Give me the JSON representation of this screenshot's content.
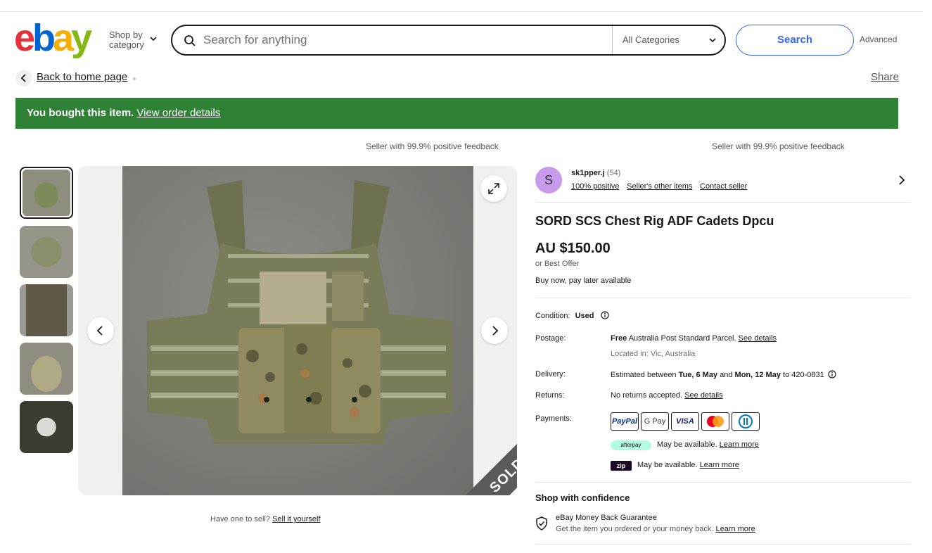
{
  "header": {
    "logo_letters": [
      "e",
      "b",
      "a",
      "y"
    ],
    "shop_by_line1": "Shop by",
    "shop_by_line2": "category",
    "search_placeholder": "Search for anything",
    "category_select": "All Categories",
    "search_button": "Search",
    "advanced_link": "Advanced"
  },
  "nav": {
    "back_link": "Back to home page",
    "share_link": "Share"
  },
  "banner": {
    "text": "You bought this item.",
    "link": "View order details",
    "color": "#2f8136"
  },
  "feedback_notes": [
    "Seller with 99.9% positive feedback",
    "Seller with 99.9% positive feedback"
  ],
  "gallery": {
    "thumbnail_count": 5,
    "selected_index": 0,
    "overlay": "SOLD"
  },
  "have_one": {
    "text": "Have one to sell?",
    "link": "Sell it yourself"
  },
  "seller": {
    "avatar_letter": "S",
    "name": "sk1pper.j",
    "feedback_count": "(54)",
    "positive": "100% positive",
    "other_items": "Seller's other items",
    "contact": "Contact seller",
    "avatar_color": "#c89bea"
  },
  "item": {
    "title": "SORD SCS Chest Rig ADF Cadets Dpcu",
    "price": "AU $150.00",
    "best_offer": "or Best Offer",
    "pay_later": "Buy now, pay later available"
  },
  "details": {
    "condition_label": "Condition:",
    "condition_value": "Used",
    "postage_label": "Postage:",
    "postage_free": "Free",
    "postage_text": "Australia Post Standard Parcel.",
    "postage_link": "See details",
    "location": "Located in: Vic, Australia",
    "delivery_label": "Delivery:",
    "delivery_prefix": "Estimated between",
    "delivery_start": "Tue, 6 May",
    "delivery_and": "and",
    "delivery_end": "Mon, 12 May",
    "delivery_to": "to 420-0831",
    "returns_label": "Returns:",
    "returns_text": "No returns accepted.",
    "returns_link": "See details",
    "payments_label": "Payments:",
    "payment_logos": [
      "PayPal",
      "G Pay",
      "VISA",
      "Mastercard",
      "Diners"
    ],
    "afterpay_badge": "afterpay",
    "afterpay_text": "May be available.",
    "afterpay_link": "Learn more",
    "zip_badge": "zip",
    "zip_text": "May be available.",
    "zip_link": "Learn more"
  },
  "confidence": {
    "heading": "Shop with confidence",
    "guarantee_title": "eBay Money Back Guarantee",
    "guarantee_text": "Get the item you ordered or your money back.",
    "guarantee_link": "Learn more"
  }
}
